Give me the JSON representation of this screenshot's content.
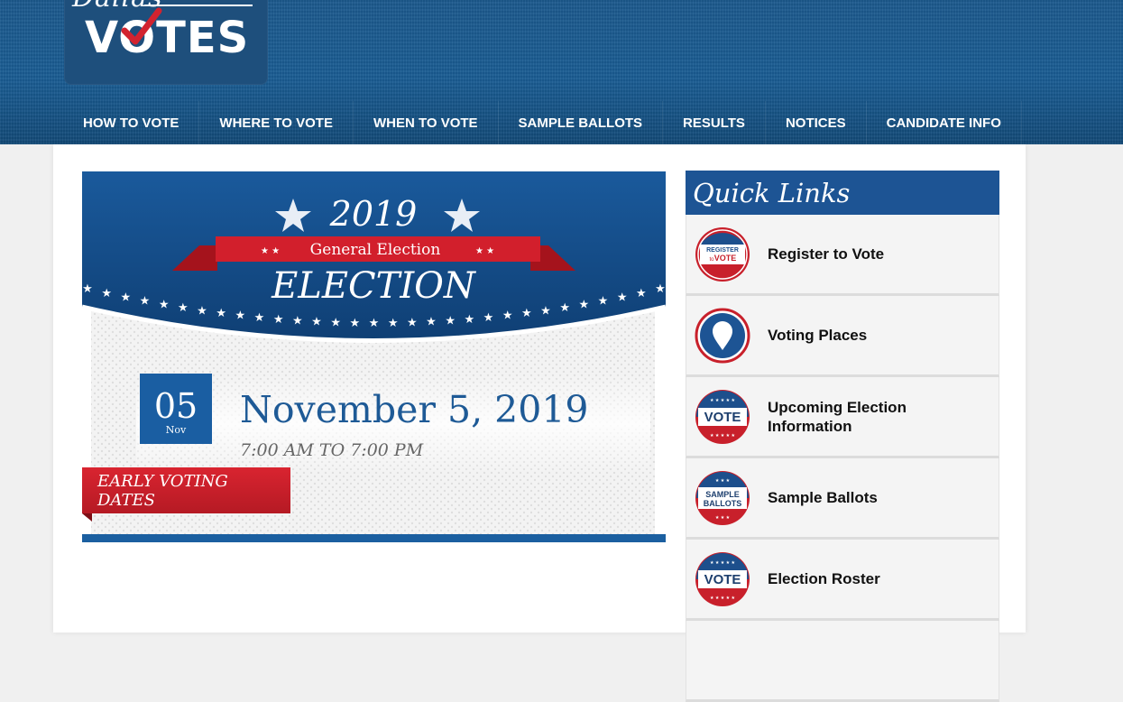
{
  "logo": {
    "script_text": "Dallas",
    "main_text": "VOTES"
  },
  "nav": [
    {
      "label": "HOW TO VOTE"
    },
    {
      "label": "WHERE TO VOTE"
    },
    {
      "label": "WHEN TO VOTE"
    },
    {
      "label": "SAMPLE BALLOTS"
    },
    {
      "label": "RESULTS"
    },
    {
      "label": "NOTICES"
    },
    {
      "label": "CANDIDATE INFO"
    }
  ],
  "banner": {
    "year": "2019",
    "ribbon": "General Election",
    "title": "ELECTION",
    "day": "05",
    "month": "Nov",
    "date": "November 5, 2019",
    "hours": "7:00 AM TO 7:00 PM",
    "early_voting": "EARLY VOTING DATES"
  },
  "quick_links": {
    "title": "Quick Links",
    "items": [
      {
        "label": "Register to Vote",
        "icon": "register-vote-icon",
        "badge": [
          "REGISTER",
          "to",
          "VOTE"
        ]
      },
      {
        "label": "Voting Places",
        "icon": "location-pin-icon"
      },
      {
        "label": "Upcoming Election\nInformation",
        "icon": "vote-badge-icon",
        "badge": [
          "VOTE"
        ]
      },
      {
        "label": "Sample Ballots",
        "icon": "sample-ballots-icon",
        "badge": [
          "SAMPLE",
          "BALLOTS"
        ]
      },
      {
        "label": "Election Roster",
        "icon": "vote-badge-icon",
        "badge": [
          "VOTE"
        ]
      }
    ]
  },
  "colors": {
    "header_blue": "#1a5d94",
    "accent_red": "#c8202b",
    "link_blue": "#1e5a96"
  }
}
